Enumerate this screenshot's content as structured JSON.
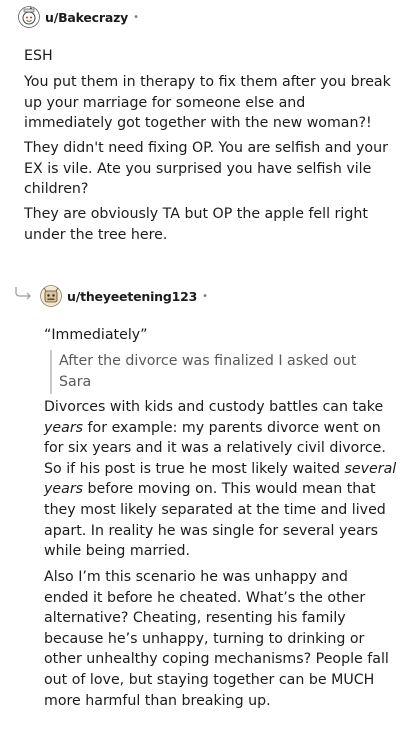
{
  "comment1": {
    "username": "u/Bakecrazy",
    "separator": "•",
    "paragraphs": {
      "p1": "ESH",
      "p2": [
        "You put them in therapy to fix them after you break",
        "up your marriage for someone else and",
        "immediately got together with the new woman?!"
      ],
      "p3": [
        "They didn't need fixing OP. You are selfish and your",
        "EX is vile. Ate you surprised you have selfish vile",
        "children?"
      ],
      "p4": [
        "They are obviously TA but OP the apple fell right",
        "under the tree here."
      ]
    }
  },
  "comment2": {
    "username": "u/theyeetening123",
    "separator": "•",
    "paragraphs": {
      "p1": "“Immediately”",
      "quote": [
        "After the divorce was finalized I asked out",
        "Sara"
      ],
      "p2": {
        "l1": "Divorces with kids and custody battles can take",
        "l2_em": "years",
        "l2_rest": " for example: my parents divorce went on",
        "l3": "for six years and it was a relatively civil divorce.",
        "l4_start": "So if his post is true he most likely waited ",
        "l4_em": "several",
        "l5_em": "years",
        "l5_rest": " before moving on. This would mean that",
        "l6": "they most likely separated at the time and lived",
        "l7": "apart. In reality he was single for several years",
        "l8": "while being married."
      },
      "p3": [
        "Also I’m this scenario he was unhappy and",
        "ended it before he cheated. What’s the other",
        "alternative? Cheating, resenting his family",
        "because he’s unhappy, turning to drinking or",
        "other unhealthy coping mechanisms? People fall",
        "out of love, but staying together can be MUCH",
        "more harmful than breaking up."
      ]
    }
  }
}
